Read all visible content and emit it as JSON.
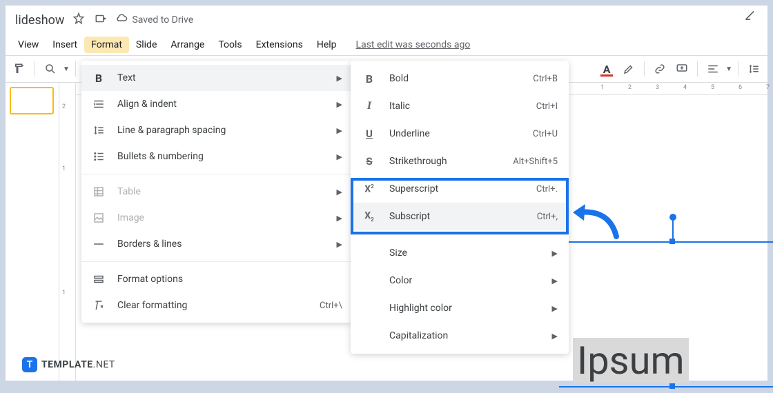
{
  "title": "lideshow",
  "saved_text": "Saved to Drive",
  "menubar": {
    "view": "View",
    "insert": "Insert",
    "format": "Format",
    "slide": "Slide",
    "arrange": "Arrange",
    "tools": "Tools",
    "extensions": "Extensions",
    "help": "Help"
  },
  "last_edit": "Last edit was seconds ago",
  "format_menu": {
    "text": "Text",
    "align": "Align & indent",
    "spacing": "Line & paragraph spacing",
    "bullets": "Bullets & numbering",
    "table": "Table",
    "image": "Image",
    "borders": "Borders & lines",
    "options": "Format options",
    "clear": "Clear formatting",
    "clear_shortcut": "Ctrl+\\"
  },
  "text_menu": {
    "bold": "Bold",
    "bold_sc": "Ctrl+B",
    "italic": "Italic",
    "italic_sc": "Ctrl+I",
    "underline": "Underline",
    "underline_sc": "Ctrl+U",
    "strike": "Strikethrough",
    "strike_sc": "Alt+Shift+5",
    "sup": "Superscript",
    "sup_sc": "Ctrl+.",
    "sub": "Subscript",
    "sub_sc": "Ctrl+,",
    "size": "Size",
    "color": "Color",
    "highlight": "Highlight color",
    "cap": "Capitalization"
  },
  "canvas_text": "Ipsum",
  "ruler_h": [
    "1",
    "2",
    "3",
    "4",
    "5",
    "6",
    "7"
  ],
  "ruler_v": [
    "2",
    "1",
    "1"
  ],
  "footer_brand": "TEMPLATE",
  "footer_net": ".NET"
}
